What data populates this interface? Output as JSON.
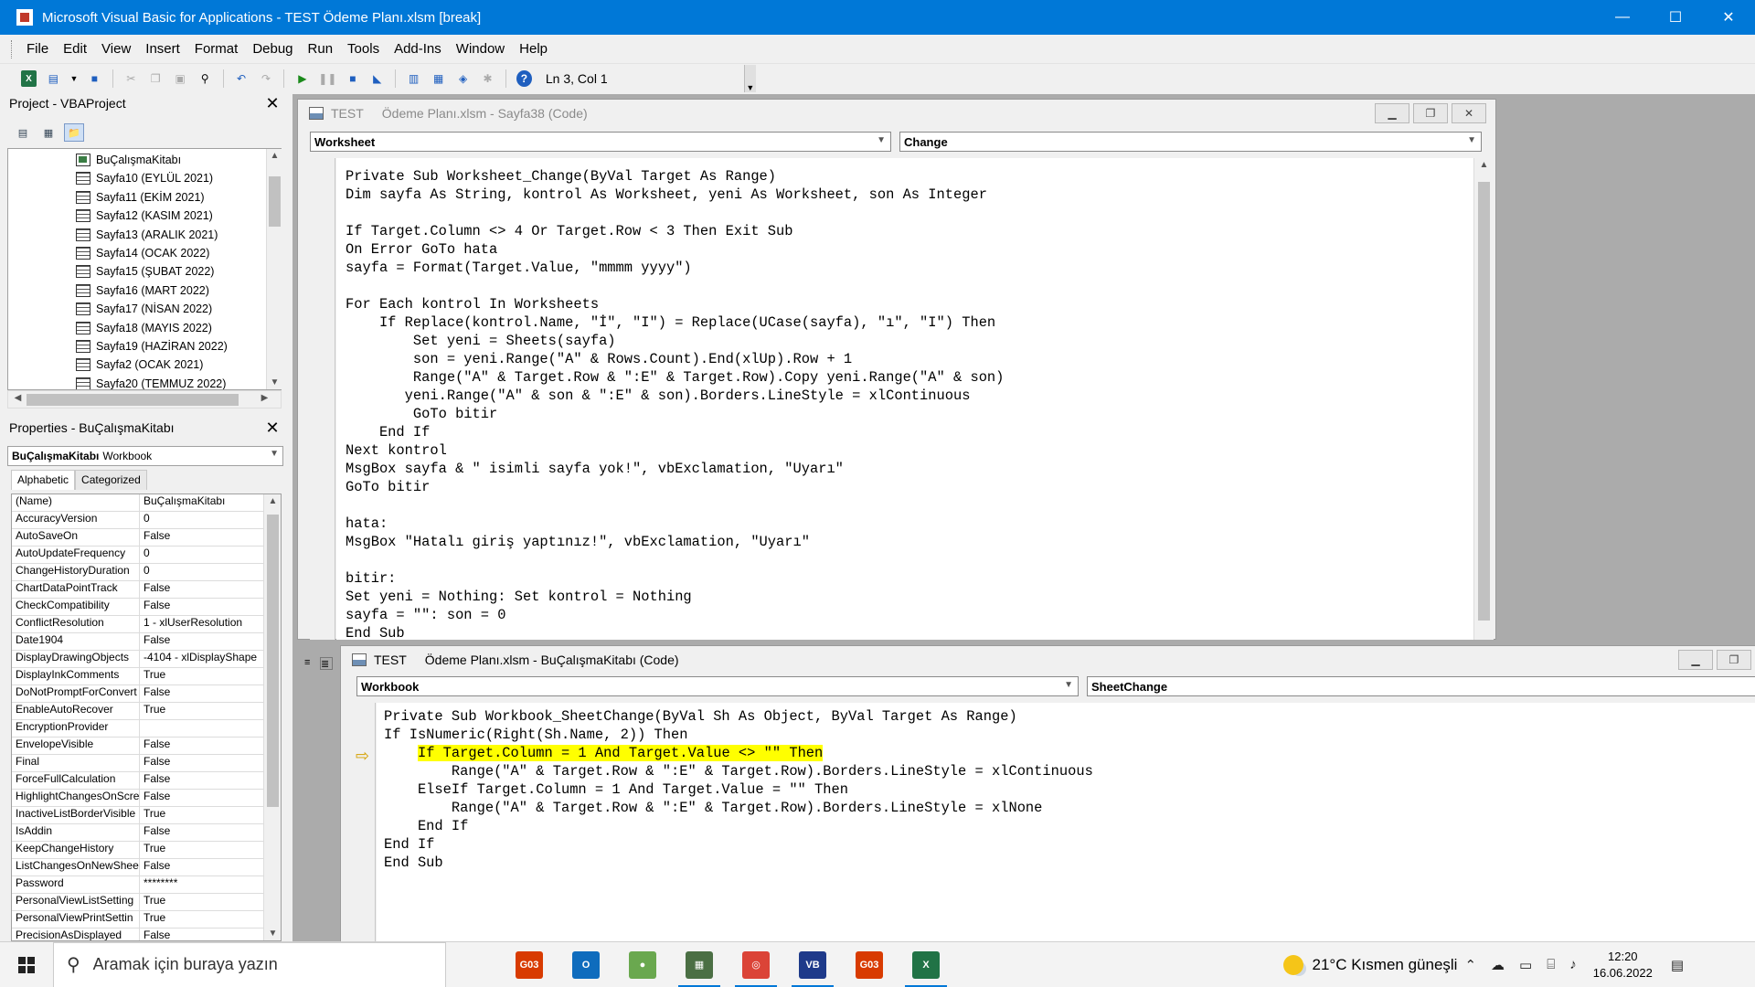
{
  "window": {
    "title": "Microsoft Visual Basic for Applications - TEST     Ödeme Planı.xlsm [break]",
    "controls": [
      "—",
      "☐",
      "✕"
    ]
  },
  "menu": [
    {
      "label": "File",
      "u": "F",
      "rest": "ile"
    },
    {
      "label": "Edit",
      "u": "E",
      "rest": "dit"
    },
    {
      "label": "View",
      "u": "V",
      "rest": "iew"
    },
    {
      "label": "Insert",
      "u": "I",
      "rest": "nsert"
    },
    {
      "label": "Format",
      "u": "o",
      "pre": "F",
      "rest": "rmat"
    },
    {
      "label": "Debug",
      "u": "D",
      "rest": "ebug"
    },
    {
      "label": "Run",
      "u": "R",
      "rest": "un"
    },
    {
      "label": "Tools",
      "u": "T",
      "rest": "ools"
    },
    {
      "label": "Add-Ins",
      "u": "A",
      "rest": "dd-Ins"
    },
    {
      "label": "Window",
      "u": "W",
      "rest": "indow"
    },
    {
      "label": "Help",
      "u": "H",
      "rest": "elp"
    }
  ],
  "toolbar": {
    "position": "Ln 3, Col 1"
  },
  "project": {
    "title": "Project - VBAProject",
    "items": [
      {
        "label": "BuÇalışmaKitabı",
        "icon": "workbook-icon"
      },
      {
        "label": "Sayfa10 (EYLÜL 2021)",
        "icon": "sheet-icon"
      },
      {
        "label": "Sayfa11 (EKİM 2021)",
        "icon": "sheet-icon"
      },
      {
        "label": "Sayfa12 (KASIM 2021)",
        "icon": "sheet-icon"
      },
      {
        "label": "Sayfa13 (ARALIK 2021)",
        "icon": "sheet-icon"
      },
      {
        "label": "Sayfa14 (OCAK 2022)",
        "icon": "sheet-icon"
      },
      {
        "label": "Sayfa15 (ŞUBAT 2022)",
        "icon": "sheet-icon"
      },
      {
        "label": "Sayfa16 (MART 2022)",
        "icon": "sheet-icon"
      },
      {
        "label": "Sayfa17 (NİSAN 2022)",
        "icon": "sheet-icon"
      },
      {
        "label": "Sayfa18 (MAYIS 2022)",
        "icon": "sheet-icon"
      },
      {
        "label": "Sayfa19 (HAZİRAN 2022)",
        "icon": "sheet-icon"
      },
      {
        "label": "Sayfa2 (OCAK 2021)",
        "icon": "sheet-icon"
      },
      {
        "label": "Sayfa20 (TEMMUZ 2022)",
        "icon": "sheet-icon"
      }
    ]
  },
  "properties": {
    "title": "Properties - BuÇalışmaKitabı",
    "object_name": "BuÇalışmaKitabı",
    "object_type": "Workbook",
    "tabs": [
      "Alphabetic",
      "Categorized"
    ],
    "rows": [
      [
        "(Name)",
        "BuÇalışmaKitabı"
      ],
      [
        "AccuracyVersion",
        "0"
      ],
      [
        "AutoSaveOn",
        "False"
      ],
      [
        "AutoUpdateFrequency",
        "0"
      ],
      [
        "ChangeHistoryDuration",
        "0"
      ],
      [
        "ChartDataPointTrack",
        "False"
      ],
      [
        "CheckCompatibility",
        "False"
      ],
      [
        "ConflictResolution",
        "1 - xlUserResolution"
      ],
      [
        "Date1904",
        "False"
      ],
      [
        "DisplayDrawingObjects",
        "-4104 - xlDisplayShape"
      ],
      [
        "DisplayInkComments",
        "True"
      ],
      [
        "DoNotPromptForConvert",
        "False"
      ],
      [
        "EnableAutoRecover",
        "True"
      ],
      [
        "EncryptionProvider",
        ""
      ],
      [
        "EnvelopeVisible",
        "False"
      ],
      [
        "Final",
        "False"
      ],
      [
        "ForceFullCalculation",
        "False"
      ],
      [
        "HighlightChangesOnScre",
        "False"
      ],
      [
        "InactiveListBorderVisible",
        "True"
      ],
      [
        "IsAddin",
        "False"
      ],
      [
        "KeepChangeHistory",
        "True"
      ],
      [
        "ListChangesOnNewShee",
        "False"
      ],
      [
        "Password",
        "********"
      ],
      [
        "PersonalViewListSetting",
        "True"
      ],
      [
        "PersonalViewPrintSettin",
        "True"
      ],
      [
        "PrecisionAsDisplayed",
        "False"
      ]
    ]
  },
  "code1": {
    "project": "TEST",
    "title": "Ödeme Planı.xlsm - Sayfa38 (Code)",
    "object": "Worksheet",
    "procedure": "Change",
    "lines": [
      "Private Sub Worksheet_Change(ByVal Target As Range)",
      "Dim sayfa As String, kontrol As Worksheet, yeni As Worksheet, son As Integer",
      "",
      "If Target.Column <> 4 Or Target.Row < 3 Then Exit Sub",
      "On Error GoTo hata",
      "sayfa = Format(Target.Value, \"mmmm yyyy\")",
      "",
      "For Each kontrol In Worksheets",
      "    If Replace(kontrol.Name, \"İ\", \"I\") = Replace(UCase(sayfa), \"ı\", \"I\") Then",
      "        Set yeni = Sheets(sayfa)",
      "        son = yeni.Range(\"A\" & Rows.Count).End(xlUp).Row + 1",
      "        Range(\"A\" & Target.Row & \":E\" & Target.Row).Copy yeni.Range(\"A\" & son)",
      "       yeni.Range(\"A\" & son & \":E\" & son).Borders.LineStyle = xlContinuous",
      "        GoTo bitir",
      "    End If",
      "Next kontrol",
      "MsgBox sayfa & \" isimli sayfa yok!\", vbExclamation, \"Uyarı\"",
      "GoTo bitir",
      "",
      "hata:",
      "MsgBox \"Hatalı giriş yaptınız!\", vbExclamation, \"Uyarı\"",
      "",
      "bitir:",
      "Set yeni = Nothing: Set kontrol = Nothing",
      "sayfa = \"\": son = 0",
      "End Sub"
    ]
  },
  "code2": {
    "project": "TEST",
    "title": "Ödeme Planı.xlsm - BuÇalışmaKitabı (Code)",
    "object": "Workbook",
    "procedure": "SheetChange",
    "lines": [
      "Private Sub Workbook_SheetChange(ByVal Sh As Object, ByVal Target As Range)",
      "If IsNumeric(Right(Sh.Name, 2)) Then",
      "    If Target.Column = 1 And Target.Value <> \"\" Then",
      "        Range(\"A\" & Target.Row & \":E\" & Target.Row).Borders.LineStyle = xlContinuous",
      "    ElseIf Target.Column = 1 And Target.Value = \"\" Then",
      "        Range(\"A\" & Target.Row & \":E\" & Target.Row).Borders.LineStyle = xlNone",
      "    End If",
      "End If",
      "End Sub"
    ],
    "current_line_index": 2,
    "highlight_color": "#ffff00"
  },
  "taskbar": {
    "search_placeholder": "Aramak için buraya yazın",
    "weather": "21°C  Kısmen güneşli",
    "time": "12:20",
    "date": "16.06.2022",
    "apps": [
      {
        "name": "presentation-app-icon",
        "label": "G03",
        "color": "#d83b01"
      },
      {
        "name": "outlook-icon",
        "label": "O",
        "color": "#0f6cbd"
      },
      {
        "name": "paint-icon",
        "label": "●",
        "color": "#6aa84f"
      },
      {
        "name": "calculator-icon",
        "label": "▦",
        "color": "#4b6f44"
      },
      {
        "name": "chrome-icon",
        "label": "◎",
        "color": "#db4437"
      },
      {
        "name": "visual-basic-icon",
        "label": "VB",
        "color": "#1e3a8a"
      },
      {
        "name": "presentation-app-icon-2",
        "label": "G03",
        "color": "#d83b01"
      },
      {
        "name": "excel-icon",
        "label": "X",
        "color": "#217346"
      }
    ]
  }
}
